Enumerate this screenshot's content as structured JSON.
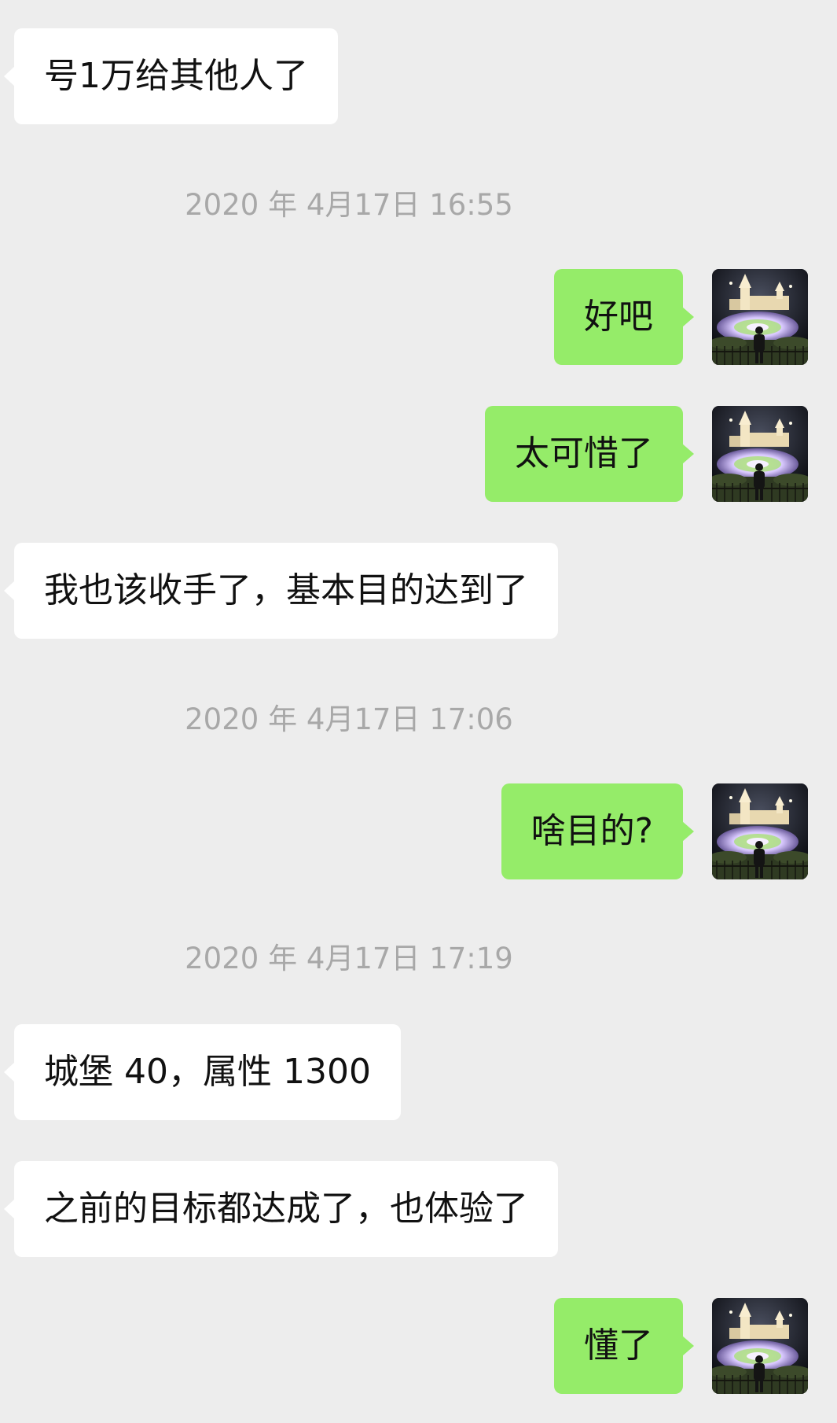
{
  "conversation": [
    {
      "type": "message",
      "side": "in",
      "text": "号1万给其他人了"
    },
    {
      "type": "timestamp",
      "text": "2020 年 4月17日 16:55"
    },
    {
      "type": "message",
      "side": "out",
      "text": "好吧"
    },
    {
      "type": "message",
      "side": "out",
      "text": "太可惜了"
    },
    {
      "type": "message",
      "side": "in",
      "text": "我也该收手了，基本目的达到了"
    },
    {
      "type": "timestamp",
      "text": "2020 年 4月17日 17:06"
    },
    {
      "type": "message",
      "side": "out",
      "text": "啥目的?"
    },
    {
      "type": "timestamp",
      "text": "2020 年 4月17日 17:19"
    },
    {
      "type": "message",
      "side": "in",
      "text": "城堡 40，属性 1300"
    },
    {
      "type": "message",
      "side": "in",
      "text": "之前的目标都达成了，也体验了"
    },
    {
      "type": "message",
      "side": "out",
      "text": "懂了"
    }
  ],
  "colors": {
    "background": "#ededed",
    "incoming_bubble": "#ffffff",
    "outgoing_bubble": "#95ec69",
    "timestamp_text": "#a8a8a8",
    "message_text": "#111111"
  },
  "avatar": {
    "icon": "user-avatar-castle-photo-icon"
  }
}
